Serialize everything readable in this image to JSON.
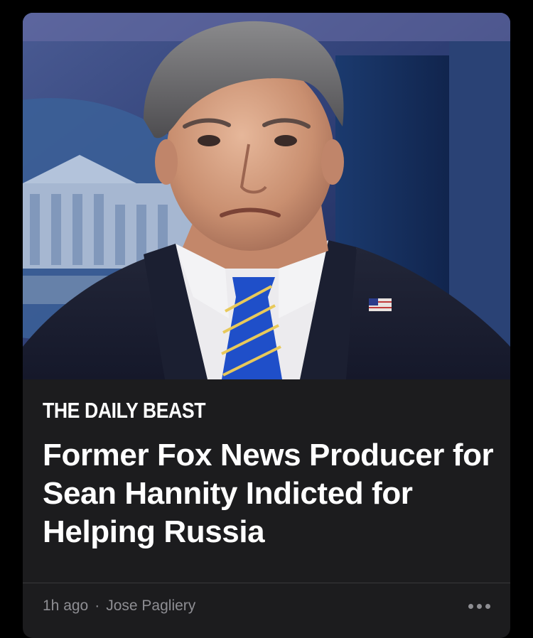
{
  "article": {
    "image_alt": "Photo of Sean Hannity in a dark suit, white shirt and blue striped tie",
    "publisher": "THE DAILY BEAST",
    "headline": "Former Fox News Producer for Sean Hannity Indicted for Helping Russia",
    "time_ago": "1h ago",
    "separator": "·",
    "author": "Jose Pagliery",
    "more_icon": "ellipsis-icon"
  },
  "colors": {
    "background": "#000000",
    "card": "#1c1c1e",
    "text": "#ffffff",
    "meta": "#8e8e93"
  }
}
